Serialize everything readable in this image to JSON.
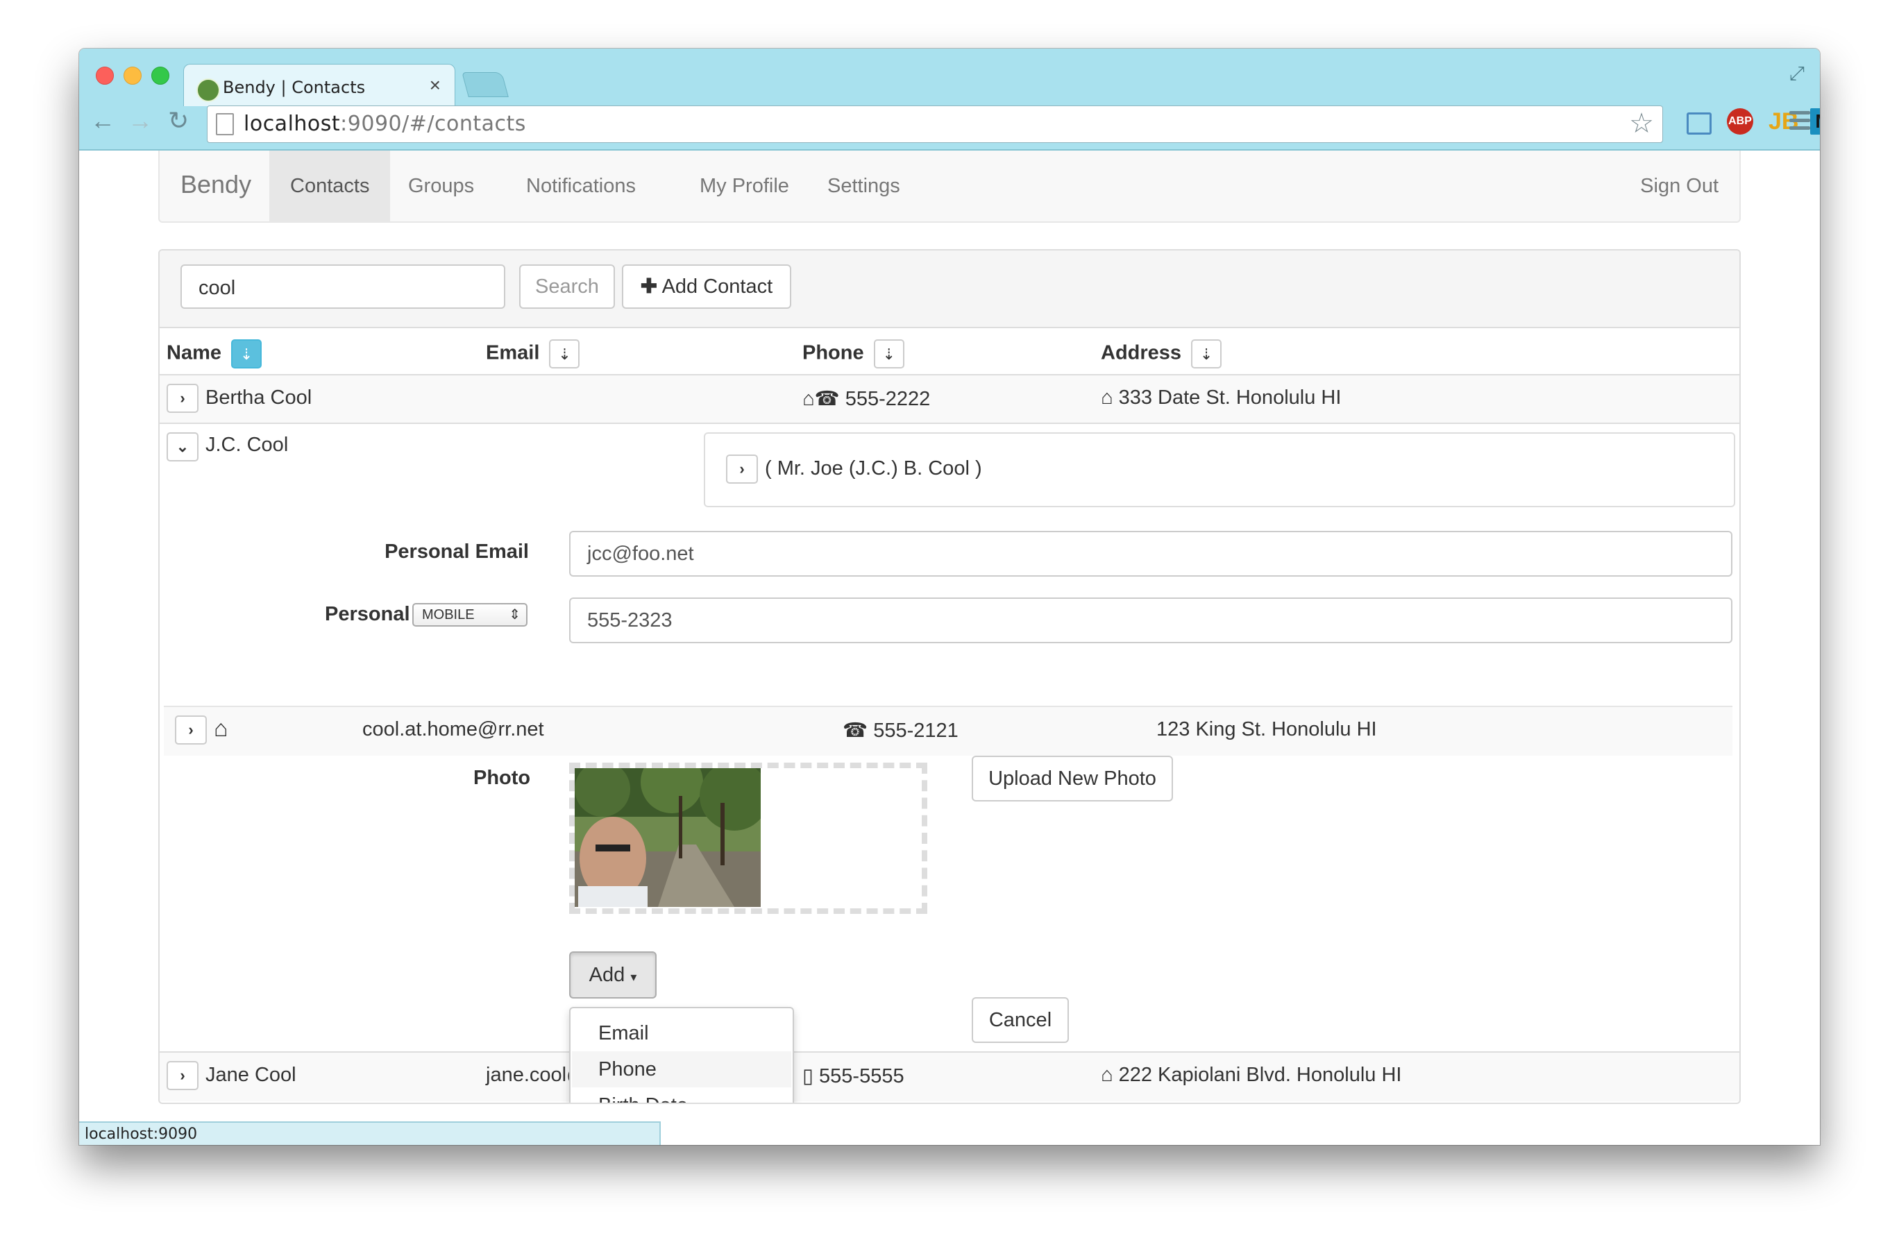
{
  "browser": {
    "tab_title": "Bendy | Contacts",
    "tab_close": "×",
    "url_host": "localhost",
    "url_rest": ":9090/#/contacts",
    "status_text": "localhost:9090"
  },
  "navbar": {
    "brand": "Bendy",
    "items": [
      {
        "label": "Contacts",
        "active": true
      },
      {
        "label": "Groups"
      },
      {
        "label": "Notifications"
      },
      {
        "label": "My Profile"
      },
      {
        "label": "Settings"
      }
    ],
    "sign_out": "Sign Out"
  },
  "search": {
    "value": "cool",
    "search_label": "Search",
    "add_contact_label": "Add Contact"
  },
  "table": {
    "headers": [
      "Name",
      "Email",
      "Phone",
      "Address"
    ],
    "rows": {
      "bertha": {
        "name": "Bertha Cool",
        "phone": "555-2222",
        "address": "333 Date St. Honolulu HI"
      },
      "jc": {
        "name": "J.C. Cool",
        "alias": "( Mr. Joe (J.C.) B. Cool )",
        "personal_email_label": "Personal Email",
        "personal_email_value": "jcc@foo.net",
        "personal_phone_label": "Personal",
        "personal_phone_type": "MOBILE",
        "personal_phone_value": "555-2323",
        "home": {
          "email": "cool.at.home@rr.net",
          "phone": "555-2121",
          "address": "123 King St. Honolulu HI"
        },
        "photo_label": "Photo",
        "upload_label": "Upload New Photo",
        "add_label": "Add",
        "add_menu": [
          "Email",
          "Phone",
          "Birth Date"
        ],
        "cancel_label": "Cancel"
      },
      "jane": {
        "name": "Jane Cool",
        "email": "jane.cool@",
        "phone": "555-5555",
        "address": "222 Kapiolani Blvd. Honolulu HI"
      }
    }
  },
  "colors": {
    "chrome": "#a9e1ee",
    "active_sort": "#5bc0de",
    "nav_bg": "#f8f8f8"
  }
}
